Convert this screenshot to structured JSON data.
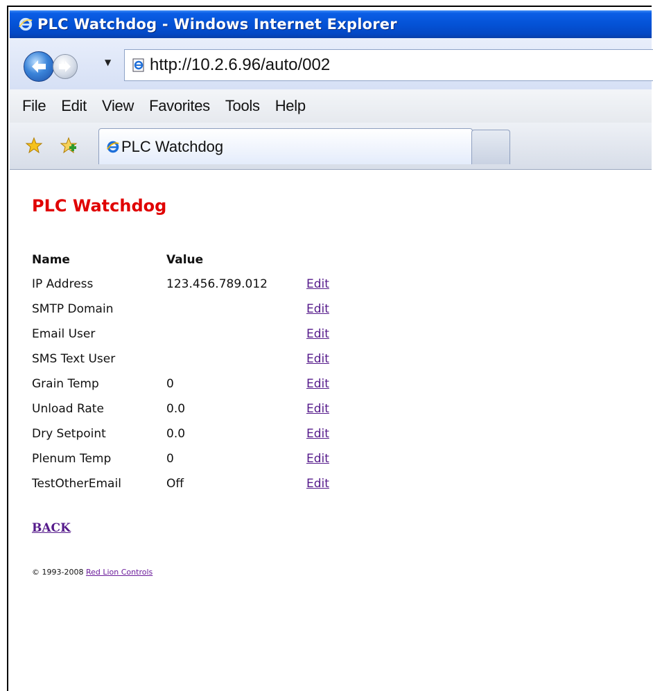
{
  "window": {
    "title": "PLC Watchdog - Windows Internet Explorer"
  },
  "address_bar": {
    "url": "http://10.2.6.96/auto/002"
  },
  "menu": {
    "items": [
      "File",
      "Edit",
      "View",
      "Favorites",
      "Tools",
      "Help"
    ]
  },
  "tabs": {
    "active_label": "PLC Watchdog"
  },
  "page": {
    "title": "PLC Watchdog",
    "table": {
      "header_name": "Name",
      "header_value": "Value",
      "rows": [
        {
          "name": "IP Address",
          "value": "123.456.789.012",
          "action": "Edit"
        },
        {
          "name": "SMTP Domain",
          "value": "",
          "action": "Edit"
        },
        {
          "name": "Email User",
          "value": "",
          "action": "Edit"
        },
        {
          "name": "SMS Text User",
          "value": "",
          "action": "Edit"
        },
        {
          "name": "Grain Temp",
          "value": "0",
          "action": "Edit"
        },
        {
          "name": "Unload Rate",
          "value": "0.0",
          "action": "Edit"
        },
        {
          "name": "Dry Setpoint",
          "value": "0.0",
          "action": "Edit"
        },
        {
          "name": "Plenum Temp",
          "value": "0",
          "action": "Edit"
        },
        {
          "name": "TestOtherEmail",
          "value": "Off",
          "action": "Edit"
        }
      ]
    },
    "back_label": "BACK",
    "footer": {
      "copyright": "© 1993-2008",
      "link_text": "Red Lion Controls"
    }
  },
  "colors": {
    "title_red": "#e00000",
    "link_visited": "#551a8b",
    "titlebar_blue": "#0452d6"
  },
  "icons": {
    "titlebar": "ie-logo-icon",
    "back": "back-arrow-icon",
    "forward": "forward-arrow-icon",
    "page": "page-icon",
    "favorites": "favorites-star-icon",
    "add_favorite": "add-favorites-icon"
  }
}
